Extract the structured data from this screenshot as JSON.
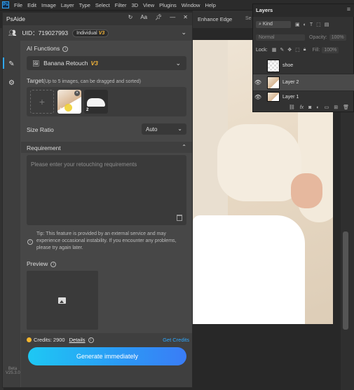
{
  "app": {
    "logo": "Ps",
    "menu": [
      "File",
      "Edit",
      "Image",
      "Layer",
      "Type",
      "Select",
      "Filter",
      "3D",
      "View",
      "Plugins",
      "Window",
      "Help"
    ]
  },
  "options_bar": {
    "enhance_edge": "Enhance Edge",
    "select_stub": "Se"
  },
  "layers_panel": {
    "title": "Layers",
    "menu_icon": "≡",
    "kind_label": "Kind",
    "blend_mode": "Normal",
    "opacity_label": "Opacity:",
    "opacity_value": "100%",
    "lock_label": "Lock:",
    "fill_label": "Fill:",
    "fill_value": "100%",
    "layers": [
      {
        "name": "shoe",
        "visible": false,
        "selected": false
      },
      {
        "name": "Layer 2",
        "visible": true,
        "selected": true
      },
      {
        "name": "Layer 1",
        "visible": true,
        "selected": false
      }
    ]
  },
  "plugin": {
    "title": "PsAide",
    "uid": "UID：719027993",
    "plan": "Individual",
    "plan_tier": "V3",
    "beta_label": "Beta",
    "version": "V25.3.0",
    "ai_functions_label": "AI Functions",
    "ai_function_value": "Banana Retouch",
    "ai_function_tier": "V3",
    "target_label": "Target",
    "target_hint": "(Up to 5 images, can be dragged and sorted)",
    "target_add": "+",
    "target_images": [
      {
        "index": "1"
      },
      {
        "index": "2"
      }
    ],
    "size_ratio_label": "Size Ratio",
    "size_ratio_value": "Auto",
    "requirement_label": "Requirement",
    "requirement_placeholder": "Please enter your retouching requirements",
    "tip": "Tip: This feature is provided by an external service and may experience occasional instability. If you encounter any problems, please try again later.",
    "preview_label": "Preview",
    "credits": "Credits: 2900",
    "details": "Details",
    "get_credits": "Get Credits",
    "generate": "Generate immediately"
  },
  "colors": {
    "accent_blue": "#2ea8ff",
    "gold": "#f0b33a",
    "panel_bg": "#474747"
  }
}
